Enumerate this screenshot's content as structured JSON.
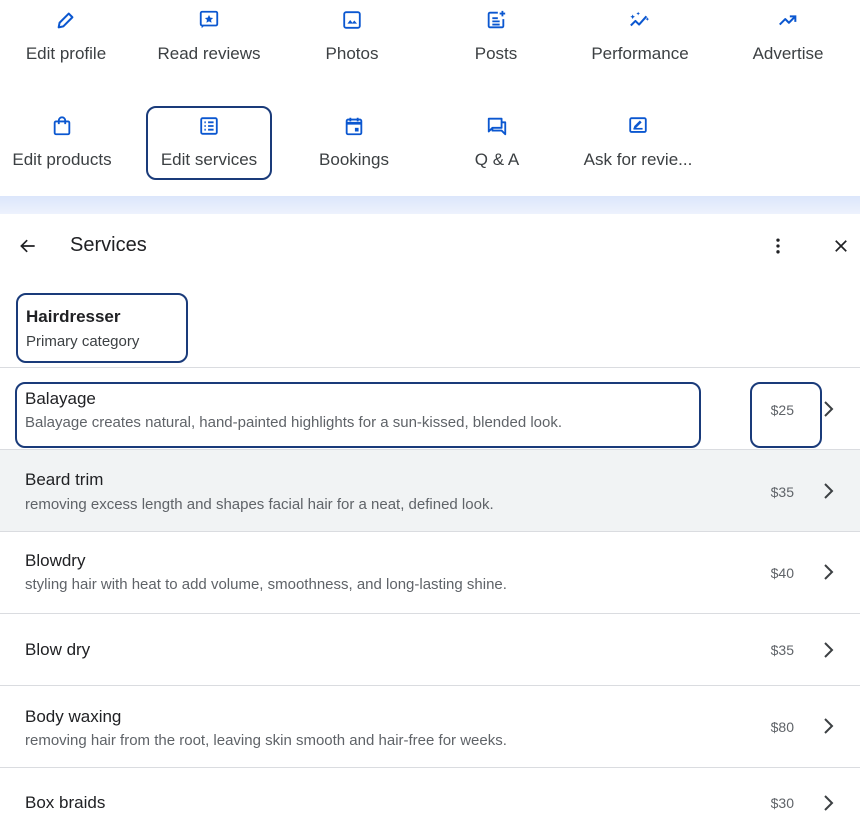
{
  "actions": {
    "row1": [
      {
        "label": "Edit profile",
        "icon": "pencil-icon"
      },
      {
        "label": "Read reviews",
        "icon": "star-review-icon"
      },
      {
        "label": "Photos",
        "icon": "photo-icon"
      },
      {
        "label": "Posts",
        "icon": "post-add-icon"
      },
      {
        "label": "Performance",
        "icon": "sparkle-trend-icon"
      },
      {
        "label": "Advertise",
        "icon": "trending-up-icon"
      }
    ],
    "row2": [
      {
        "label": "Edit products",
        "icon": "shopping-bag-icon"
      },
      {
        "label": "Edit services",
        "icon": "list-icon"
      },
      {
        "label": "Bookings",
        "icon": "calendar-icon"
      },
      {
        "label": "Q & A",
        "icon": "chat-icon"
      },
      {
        "label": "Ask for revie...",
        "icon": "review-request-icon"
      }
    ]
  },
  "header": {
    "title": "Services"
  },
  "category": {
    "name": "Hairdresser",
    "type": "Primary category"
  },
  "services": [
    {
      "name": "Balayage",
      "description": "Balayage creates natural, hand-painted highlights for a sun-kissed, blended look.",
      "price": "$25"
    },
    {
      "name": "Beard trim",
      "description": "removing excess length and shapes facial hair for a neat, defined look.",
      "price": "$35"
    },
    {
      "name": "Blowdry",
      "description": "styling hair with heat to add volume, smoothness, and long-lasting shine.",
      "price": "$40"
    },
    {
      "name": "Blow dry",
      "description": "",
      "price": "$35"
    },
    {
      "name": "Body waxing",
      "description": "removing hair from the root, leaving skin smooth and hair-free for weeks.",
      "price": "$80"
    },
    {
      "name": "Box braids",
      "description": "",
      "price": "$30"
    }
  ],
  "colors": {
    "accent": "#0b57d0",
    "highlight_border": "#1a3b7a",
    "band": "#dbe6fb"
  }
}
